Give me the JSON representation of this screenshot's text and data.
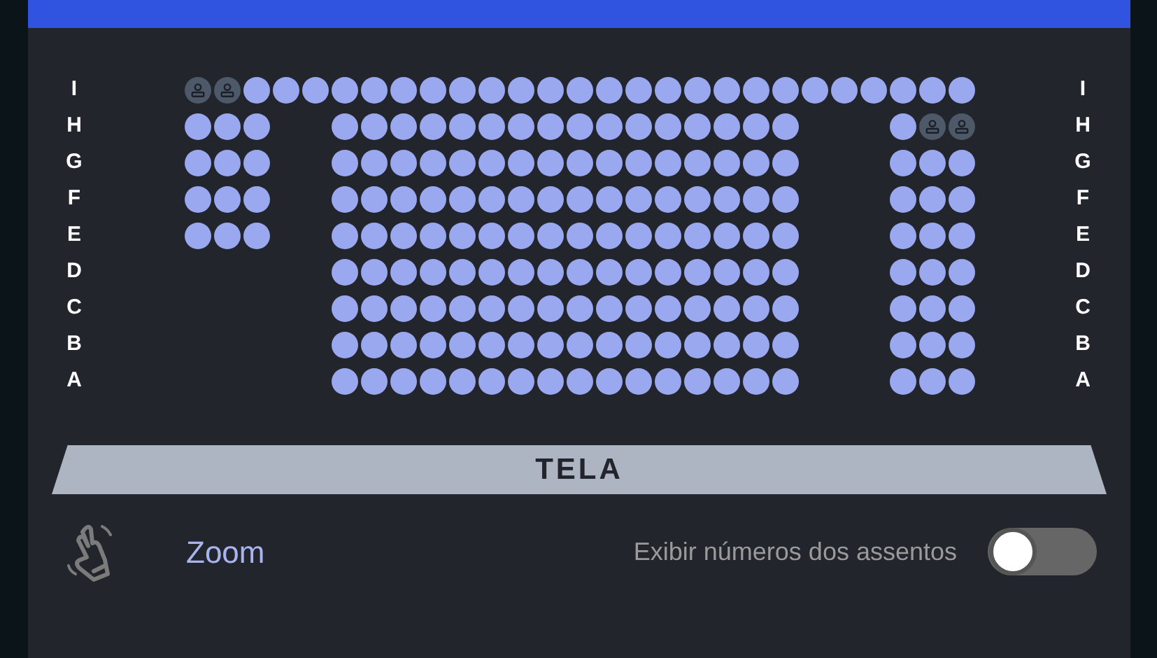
{
  "rows": [
    {
      "label_left": "I",
      "label_right": "I",
      "seats": [
        {
          "kind": "seat",
          "occupied": true
        },
        {
          "kind": "seat",
          "occupied": true
        },
        {
          "kind": "seat",
          "occupied": false
        },
        {
          "kind": "seat",
          "occupied": false
        },
        {
          "kind": "seat",
          "occupied": false
        },
        {
          "kind": "seat",
          "occupied": false
        },
        {
          "kind": "seat",
          "occupied": false
        },
        {
          "kind": "seat",
          "occupied": false
        },
        {
          "kind": "seat",
          "occupied": false
        },
        {
          "kind": "seat",
          "occupied": false
        },
        {
          "kind": "seat",
          "occupied": false
        },
        {
          "kind": "seat",
          "occupied": false
        },
        {
          "kind": "seat",
          "occupied": false
        },
        {
          "kind": "seat",
          "occupied": false
        },
        {
          "kind": "seat",
          "occupied": false
        },
        {
          "kind": "seat",
          "occupied": false
        },
        {
          "kind": "seat",
          "occupied": false
        },
        {
          "kind": "seat",
          "occupied": false
        },
        {
          "kind": "seat",
          "occupied": false
        },
        {
          "kind": "seat",
          "occupied": false
        },
        {
          "kind": "seat",
          "occupied": false
        },
        {
          "kind": "seat",
          "occupied": false
        },
        {
          "kind": "seat",
          "occupied": false
        },
        {
          "kind": "seat",
          "occupied": false
        },
        {
          "kind": "seat",
          "occupied": false
        },
        {
          "kind": "seat",
          "occupied": false
        },
        {
          "kind": "seat",
          "occupied": false
        }
      ]
    },
    {
      "label_left": "H",
      "label_right": "H",
      "seats": [
        {
          "kind": "seat",
          "occupied": false
        },
        {
          "kind": "seat",
          "occupied": false
        },
        {
          "kind": "seat",
          "occupied": false
        },
        {
          "kind": "space"
        },
        {
          "kind": "space"
        },
        {
          "kind": "seat",
          "occupied": false
        },
        {
          "kind": "seat",
          "occupied": false
        },
        {
          "kind": "seat",
          "occupied": false
        },
        {
          "kind": "seat",
          "occupied": false
        },
        {
          "kind": "seat",
          "occupied": false
        },
        {
          "kind": "seat",
          "occupied": false
        },
        {
          "kind": "seat",
          "occupied": false
        },
        {
          "kind": "seat",
          "occupied": false
        },
        {
          "kind": "seat",
          "occupied": false
        },
        {
          "kind": "seat",
          "occupied": false
        },
        {
          "kind": "seat",
          "occupied": false
        },
        {
          "kind": "seat",
          "occupied": false
        },
        {
          "kind": "seat",
          "occupied": false
        },
        {
          "kind": "seat",
          "occupied": false
        },
        {
          "kind": "seat",
          "occupied": false
        },
        {
          "kind": "seat",
          "occupied": false
        },
        {
          "kind": "space"
        },
        {
          "kind": "space"
        },
        {
          "kind": "space"
        },
        {
          "kind": "seat",
          "occupied": false
        },
        {
          "kind": "seat",
          "occupied": true
        },
        {
          "kind": "seat",
          "occupied": true
        }
      ]
    },
    {
      "label_left": "G",
      "label_right": "G",
      "seats": [
        {
          "kind": "seat",
          "occupied": false
        },
        {
          "kind": "seat",
          "occupied": false
        },
        {
          "kind": "seat",
          "occupied": false
        },
        {
          "kind": "space"
        },
        {
          "kind": "space"
        },
        {
          "kind": "seat",
          "occupied": false
        },
        {
          "kind": "seat",
          "occupied": false
        },
        {
          "kind": "seat",
          "occupied": false
        },
        {
          "kind": "seat",
          "occupied": false
        },
        {
          "kind": "seat",
          "occupied": false
        },
        {
          "kind": "seat",
          "occupied": false
        },
        {
          "kind": "seat",
          "occupied": false
        },
        {
          "kind": "seat",
          "occupied": false
        },
        {
          "kind": "seat",
          "occupied": false
        },
        {
          "kind": "seat",
          "occupied": false
        },
        {
          "kind": "seat",
          "occupied": false
        },
        {
          "kind": "seat",
          "occupied": false
        },
        {
          "kind": "seat",
          "occupied": false
        },
        {
          "kind": "seat",
          "occupied": false
        },
        {
          "kind": "seat",
          "occupied": false
        },
        {
          "kind": "seat",
          "occupied": false
        },
        {
          "kind": "space"
        },
        {
          "kind": "space"
        },
        {
          "kind": "space"
        },
        {
          "kind": "seat",
          "occupied": false
        },
        {
          "kind": "seat",
          "occupied": false
        },
        {
          "kind": "seat",
          "occupied": false
        }
      ]
    },
    {
      "label_left": "F",
      "label_right": "F",
      "seats": [
        {
          "kind": "seat",
          "occupied": false
        },
        {
          "kind": "seat",
          "occupied": false
        },
        {
          "kind": "seat",
          "occupied": false
        },
        {
          "kind": "space"
        },
        {
          "kind": "space"
        },
        {
          "kind": "seat",
          "occupied": false
        },
        {
          "kind": "seat",
          "occupied": false
        },
        {
          "kind": "seat",
          "occupied": false
        },
        {
          "kind": "seat",
          "occupied": false
        },
        {
          "kind": "seat",
          "occupied": false
        },
        {
          "kind": "seat",
          "occupied": false
        },
        {
          "kind": "seat",
          "occupied": false
        },
        {
          "kind": "seat",
          "occupied": false
        },
        {
          "kind": "seat",
          "occupied": false
        },
        {
          "kind": "seat",
          "occupied": false
        },
        {
          "kind": "seat",
          "occupied": false
        },
        {
          "kind": "seat",
          "occupied": false
        },
        {
          "kind": "seat",
          "occupied": false
        },
        {
          "kind": "seat",
          "occupied": false
        },
        {
          "kind": "seat",
          "occupied": false
        },
        {
          "kind": "seat",
          "occupied": false
        },
        {
          "kind": "space"
        },
        {
          "kind": "space"
        },
        {
          "kind": "space"
        },
        {
          "kind": "seat",
          "occupied": false
        },
        {
          "kind": "seat",
          "occupied": false
        },
        {
          "kind": "seat",
          "occupied": false
        }
      ]
    },
    {
      "label_left": "E",
      "label_right": "E",
      "seats": [
        {
          "kind": "seat",
          "occupied": false
        },
        {
          "kind": "seat",
          "occupied": false
        },
        {
          "kind": "seat",
          "occupied": false
        },
        {
          "kind": "space"
        },
        {
          "kind": "space"
        },
        {
          "kind": "seat",
          "occupied": false
        },
        {
          "kind": "seat",
          "occupied": false
        },
        {
          "kind": "seat",
          "occupied": false
        },
        {
          "kind": "seat",
          "occupied": false
        },
        {
          "kind": "seat",
          "occupied": false
        },
        {
          "kind": "seat",
          "occupied": false
        },
        {
          "kind": "seat",
          "occupied": false
        },
        {
          "kind": "seat",
          "occupied": false
        },
        {
          "kind": "seat",
          "occupied": false
        },
        {
          "kind": "seat",
          "occupied": false
        },
        {
          "kind": "seat",
          "occupied": false
        },
        {
          "kind": "seat",
          "occupied": false
        },
        {
          "kind": "seat",
          "occupied": false
        },
        {
          "kind": "seat",
          "occupied": false
        },
        {
          "kind": "seat",
          "occupied": false
        },
        {
          "kind": "seat",
          "occupied": false
        },
        {
          "kind": "space"
        },
        {
          "kind": "space"
        },
        {
          "kind": "space"
        },
        {
          "kind": "seat",
          "occupied": false
        },
        {
          "kind": "seat",
          "occupied": false
        },
        {
          "kind": "seat",
          "occupied": false
        }
      ]
    },
    {
      "label_left": "D",
      "label_right": "D",
      "seats": [
        {
          "kind": "space"
        },
        {
          "kind": "space"
        },
        {
          "kind": "space"
        },
        {
          "kind": "space"
        },
        {
          "kind": "space"
        },
        {
          "kind": "seat",
          "occupied": false
        },
        {
          "kind": "seat",
          "occupied": false
        },
        {
          "kind": "seat",
          "occupied": false
        },
        {
          "kind": "seat",
          "occupied": false
        },
        {
          "kind": "seat",
          "occupied": false
        },
        {
          "kind": "seat",
          "occupied": false
        },
        {
          "kind": "seat",
          "occupied": false
        },
        {
          "kind": "seat",
          "occupied": false
        },
        {
          "kind": "seat",
          "occupied": false
        },
        {
          "kind": "seat",
          "occupied": false
        },
        {
          "kind": "seat",
          "occupied": false
        },
        {
          "kind": "seat",
          "occupied": false
        },
        {
          "kind": "seat",
          "occupied": false
        },
        {
          "kind": "seat",
          "occupied": false
        },
        {
          "kind": "seat",
          "occupied": false
        },
        {
          "kind": "seat",
          "occupied": false
        },
        {
          "kind": "space"
        },
        {
          "kind": "space"
        },
        {
          "kind": "space"
        },
        {
          "kind": "seat",
          "occupied": false
        },
        {
          "kind": "seat",
          "occupied": false
        },
        {
          "kind": "seat",
          "occupied": false
        }
      ]
    },
    {
      "label_left": "C",
      "label_right": "C",
      "seats": [
        {
          "kind": "space"
        },
        {
          "kind": "space"
        },
        {
          "kind": "space"
        },
        {
          "kind": "space"
        },
        {
          "kind": "space"
        },
        {
          "kind": "seat",
          "occupied": false
        },
        {
          "kind": "seat",
          "occupied": false
        },
        {
          "kind": "seat",
          "occupied": false
        },
        {
          "kind": "seat",
          "occupied": false
        },
        {
          "kind": "seat",
          "occupied": false
        },
        {
          "kind": "seat",
          "occupied": false
        },
        {
          "kind": "seat",
          "occupied": false
        },
        {
          "kind": "seat",
          "occupied": false
        },
        {
          "kind": "seat",
          "occupied": false
        },
        {
          "kind": "seat",
          "occupied": false
        },
        {
          "kind": "seat",
          "occupied": false
        },
        {
          "kind": "seat",
          "occupied": false
        },
        {
          "kind": "seat",
          "occupied": false
        },
        {
          "kind": "seat",
          "occupied": false
        },
        {
          "kind": "seat",
          "occupied": false
        },
        {
          "kind": "seat",
          "occupied": false
        },
        {
          "kind": "space"
        },
        {
          "kind": "space"
        },
        {
          "kind": "space"
        },
        {
          "kind": "seat",
          "occupied": false
        },
        {
          "kind": "seat",
          "occupied": false
        },
        {
          "kind": "seat",
          "occupied": false
        }
      ]
    },
    {
      "label_left": "B",
      "label_right": "B",
      "seats": [
        {
          "kind": "space"
        },
        {
          "kind": "space"
        },
        {
          "kind": "space"
        },
        {
          "kind": "space"
        },
        {
          "kind": "space"
        },
        {
          "kind": "seat",
          "occupied": false
        },
        {
          "kind": "seat",
          "occupied": false
        },
        {
          "kind": "seat",
          "occupied": false
        },
        {
          "kind": "seat",
          "occupied": false
        },
        {
          "kind": "seat",
          "occupied": false
        },
        {
          "kind": "seat",
          "occupied": false
        },
        {
          "kind": "seat",
          "occupied": false
        },
        {
          "kind": "seat",
          "occupied": false
        },
        {
          "kind": "seat",
          "occupied": false
        },
        {
          "kind": "seat",
          "occupied": false
        },
        {
          "kind": "seat",
          "occupied": false
        },
        {
          "kind": "seat",
          "occupied": false
        },
        {
          "kind": "seat",
          "occupied": false
        },
        {
          "kind": "seat",
          "occupied": false
        },
        {
          "kind": "seat",
          "occupied": false
        },
        {
          "kind": "seat",
          "occupied": false
        },
        {
          "kind": "space"
        },
        {
          "kind": "space"
        },
        {
          "kind": "space"
        },
        {
          "kind": "seat",
          "occupied": false
        },
        {
          "kind": "seat",
          "occupied": false
        },
        {
          "kind": "seat",
          "occupied": false
        }
      ]
    },
    {
      "label_left": "A",
      "label_right": "A",
      "seats": [
        {
          "kind": "space"
        },
        {
          "kind": "space"
        },
        {
          "kind": "space"
        },
        {
          "kind": "space"
        },
        {
          "kind": "space"
        },
        {
          "kind": "seat",
          "occupied": false
        },
        {
          "kind": "seat",
          "occupied": false
        },
        {
          "kind": "seat",
          "occupied": false
        },
        {
          "kind": "seat",
          "occupied": false
        },
        {
          "kind": "seat",
          "occupied": false
        },
        {
          "kind": "seat",
          "occupied": false
        },
        {
          "kind": "seat",
          "occupied": false
        },
        {
          "kind": "seat",
          "occupied": false
        },
        {
          "kind": "seat",
          "occupied": false
        },
        {
          "kind": "seat",
          "occupied": false
        },
        {
          "kind": "seat",
          "occupied": false
        },
        {
          "kind": "seat",
          "occupied": false
        },
        {
          "kind": "seat",
          "occupied": false
        },
        {
          "kind": "seat",
          "occupied": false
        },
        {
          "kind": "seat",
          "occupied": false
        },
        {
          "kind": "seat",
          "occupied": false
        },
        {
          "kind": "space"
        },
        {
          "kind": "space"
        },
        {
          "kind": "space"
        },
        {
          "kind": "seat",
          "occupied": false
        },
        {
          "kind": "seat",
          "occupied": false
        },
        {
          "kind": "seat",
          "occupied": false
        }
      ]
    }
  ],
  "screen": {
    "label": "TELA"
  },
  "zoom": {
    "label": "Zoom"
  },
  "seat_numbers_toggle": {
    "label": "Exibir números dos assentos",
    "on": false
  }
}
